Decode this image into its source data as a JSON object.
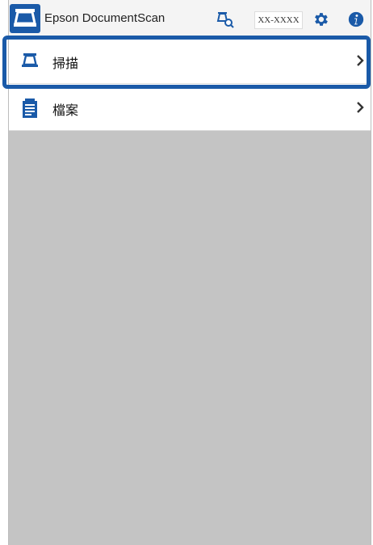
{
  "app": {
    "title": "Epson DocumentScan"
  },
  "toolbar": {
    "scanner_name": "XX-XXXX",
    "icons": [
      "scanner-search-icon",
      "gear-icon",
      "info-icon"
    ]
  },
  "menu": {
    "items": [
      {
        "label": "掃描",
        "icon": "scan-icon",
        "chevron": "chevron-right-icon"
      },
      {
        "label": "檔案",
        "icon": "document-icon",
        "chevron": "chevron-right-icon"
      }
    ]
  },
  "colors": {
    "accent": "#1a5aa8",
    "titlebar_bg": "#f4f4f4",
    "content_bg": "#c4c4c4"
  }
}
